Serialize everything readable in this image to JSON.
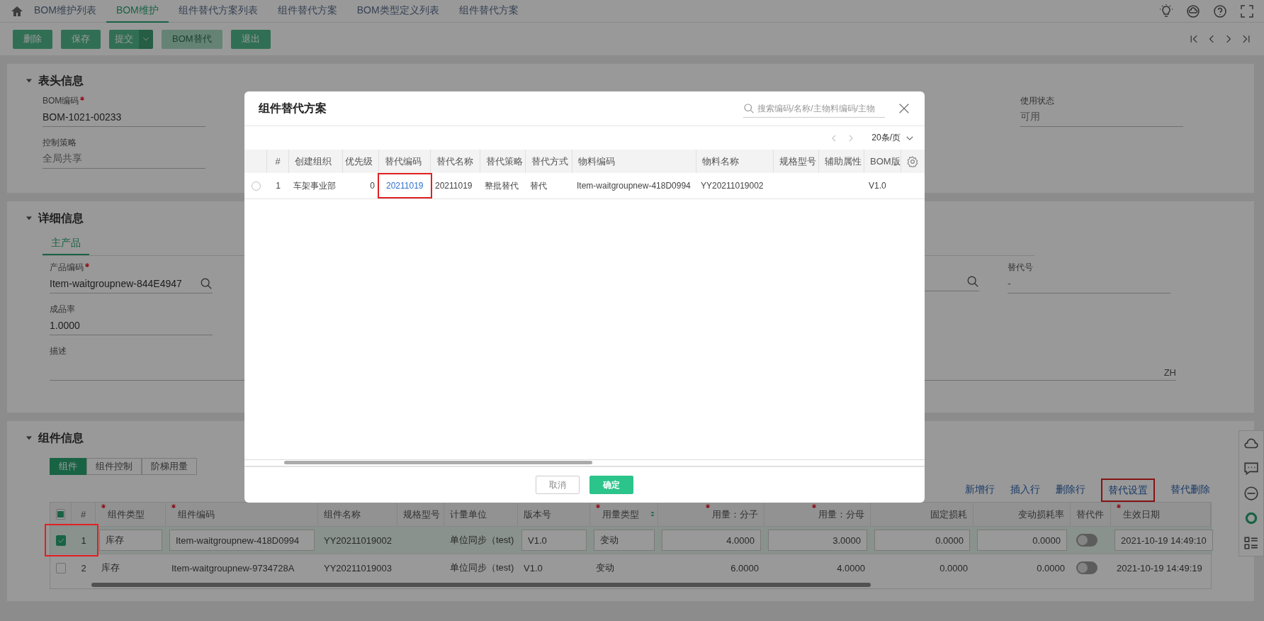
{
  "nav_tabs": [
    {
      "label": "BOM维护列表",
      "selected": false
    },
    {
      "label": "BOM维护",
      "selected": true
    },
    {
      "label": "组件替代方案列表",
      "selected": false
    },
    {
      "label": "组件替代方案",
      "selected": false
    },
    {
      "label": "BOM类型定义列表",
      "selected": false
    },
    {
      "label": "组件替代方案",
      "selected": false
    }
  ],
  "toolbar": {
    "buttons": [
      {
        "label": "删除",
        "kind": "plain",
        "disabled": false
      },
      {
        "label": "保存",
        "kind": "plain",
        "disabled": false
      },
      {
        "label": "提交",
        "kind": "split",
        "disabled": false
      },
      {
        "label": "BOM替代",
        "kind": "plain",
        "disabled": true
      },
      {
        "label": "退出",
        "kind": "plain",
        "disabled": false
      }
    ]
  },
  "header_section": {
    "title": "表头信息",
    "fields_left": [
      {
        "label": "BOM编码",
        "required": true,
        "value": "BOM-1021-00233",
        "readonly": false,
        "lookup": false
      },
      {
        "label": "控制策略",
        "required": false,
        "value": "全局共享",
        "readonly": true,
        "lookup": false
      }
    ],
    "fields_right": [
      {
        "label": "使用状态",
        "required": false,
        "value": "可用",
        "readonly": true,
        "lookup": false
      }
    ]
  },
  "detail_section": {
    "title": "详细信息",
    "tabs": [
      {
        "label": "主产品",
        "selected": true
      }
    ],
    "fields_left": [
      {
        "label": "产品编码",
        "required": true,
        "value": "Item-waitgroupnew-844E4947",
        "readonly": false,
        "lookup": true
      },
      {
        "label": "成品率",
        "required": false,
        "value": "1.0000",
        "readonly": false,
        "lookup": false
      }
    ],
    "fields_right": [
      {
        "label": "替代号",
        "required": false,
        "value": "-",
        "readonly": true,
        "lookup": false
      }
    ],
    "description": {
      "label": "描述",
      "lang": "ZH"
    }
  },
  "components_section": {
    "title": "组件信息",
    "tabs": [
      {
        "label": "组件",
        "selected": true
      },
      {
        "label": "组件控制",
        "selected": false
      },
      {
        "label": "阶梯用量",
        "selected": false
      }
    ],
    "actions": [
      {
        "label": "新增行",
        "highlighted": false
      },
      {
        "label": "插入行",
        "highlighted": false
      },
      {
        "label": "删除行",
        "highlighted": false
      },
      {
        "label": "替代设置",
        "highlighted": true
      },
      {
        "label": "替代删除",
        "highlighted": false
      }
    ],
    "select_all": {
      "checked": false,
      "indeterminate": true
    },
    "columns": [
      {
        "label": "#",
        "required": false,
        "sortable": false
      },
      {
        "label": "组件类型",
        "required": true,
        "sortable": false
      },
      {
        "label": "组件编码",
        "required": true,
        "sortable": false
      },
      {
        "label": "组件名称",
        "required": false,
        "sortable": false
      },
      {
        "label": "规格型号",
        "required": false,
        "sortable": false
      },
      {
        "label": "计量单位",
        "required": false,
        "sortable": false
      },
      {
        "label": "版本号",
        "required": false,
        "sortable": false
      },
      {
        "label": "用量类型",
        "required": true,
        "sortable": true
      },
      {
        "label": "用量：分子",
        "required": true,
        "sortable": false
      },
      {
        "label": "用量：分母",
        "required": true,
        "sortable": false
      },
      {
        "label": "固定损耗",
        "required": false,
        "sortable": false
      },
      {
        "label": "变动损耗率",
        "required": false,
        "sortable": false
      },
      {
        "label": "替代件",
        "required": false,
        "sortable": false
      },
      {
        "label": "生效日期",
        "required": true,
        "sortable": false
      }
    ],
    "rows": [
      {
        "selected": true,
        "highlighted": true,
        "editing": true,
        "index": "1",
        "component_type": "库存",
        "component_code": "Item-waitgroupnew-418D0994",
        "component_name": "YY20211019002",
        "unit": "单位同步（test)",
        "version": "V1.0",
        "usage_type": "变动",
        "numerator": "4.0000",
        "denominator": "3.0000",
        "fixed_loss": "0.0000",
        "variable_loss_rate": "0.0000",
        "substitute_on": false,
        "effective_date": "2021-10-19 14:49:10"
      },
      {
        "selected": false,
        "highlighted": false,
        "editing": false,
        "index": "2",
        "component_type": "库存",
        "component_code": "Item-waitgroupnew-9734728A",
        "component_name": "YY20211019003",
        "unit": "单位同步（test)",
        "version": "V1.0",
        "usage_type": "变动",
        "numerator": "6.0000",
        "denominator": "4.0000",
        "fixed_loss": "0.0000",
        "variable_loss_rate": "0.0000",
        "substitute_on": false,
        "effective_date": "2021-10-19 14:49:19"
      }
    ]
  },
  "modal": {
    "title": "组件替代方案",
    "search": {
      "placeholder": "搜索编码/名称/主物料编码/主物"
    },
    "page_size": "20条/页",
    "columns": [
      "#",
      "创建组织",
      "优先级",
      "替代编码",
      "替代名称",
      "替代策略",
      "替代方式",
      "物料编码",
      "物料名称",
      "规格型号",
      "辅助属性",
      "BOM版"
    ],
    "rows": [
      {
        "selected": false,
        "index": "1",
        "org": "车架事业部",
        "priority": "0",
        "code": "20211019",
        "code_highlighted": true,
        "name": "20211019",
        "strategy": "整批替代",
        "method": "替代",
        "material_code": "Item-waitgroupnew-418D0994",
        "material_name": "YY20211019002",
        "bom_version": "V1.0"
      }
    ],
    "buttons": [
      {
        "label": "取消",
        "kind": "secondary"
      },
      {
        "label": "确定",
        "kind": "primary"
      }
    ]
  }
}
